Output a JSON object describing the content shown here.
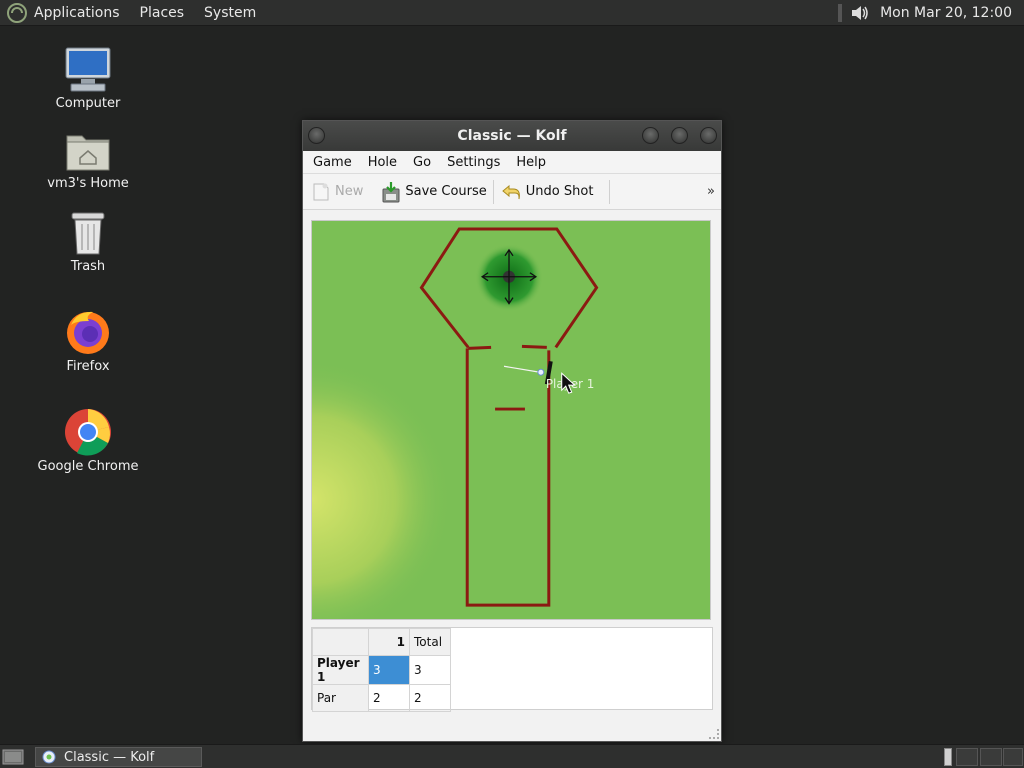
{
  "panel": {
    "menus": [
      "Applications",
      "Places",
      "System"
    ],
    "clock": "Mon Mar 20, 12:00"
  },
  "desktop": {
    "icons": [
      {
        "label": "Computer",
        "icon": "computer-icon"
      },
      {
        "label": "vm3's Home",
        "icon": "home-folder-icon"
      },
      {
        "label": "Trash",
        "icon": "trash-icon"
      },
      {
        "label": "Firefox",
        "icon": "firefox-icon"
      },
      {
        "label": "Google Chrome",
        "icon": "chrome-icon"
      }
    ]
  },
  "window": {
    "title": "Classic  — Kolf",
    "menus": [
      "Game",
      "Hole",
      "Go",
      "Settings",
      "Help"
    ],
    "toolbar": {
      "new_label": "New",
      "save_label": "Save Course",
      "undo_label": "Undo Shot",
      "more_label": "»"
    },
    "course": {
      "player_label": "Player 1"
    },
    "score": {
      "header_hole": "1",
      "header_total": "Total",
      "rows": [
        {
          "name": "Player 1",
          "hole": "3",
          "total": "3"
        },
        {
          "name": "Par",
          "hole": "2",
          "total": "2"
        }
      ]
    }
  },
  "taskbar": {
    "task_label": "Classic  — Kolf"
  }
}
